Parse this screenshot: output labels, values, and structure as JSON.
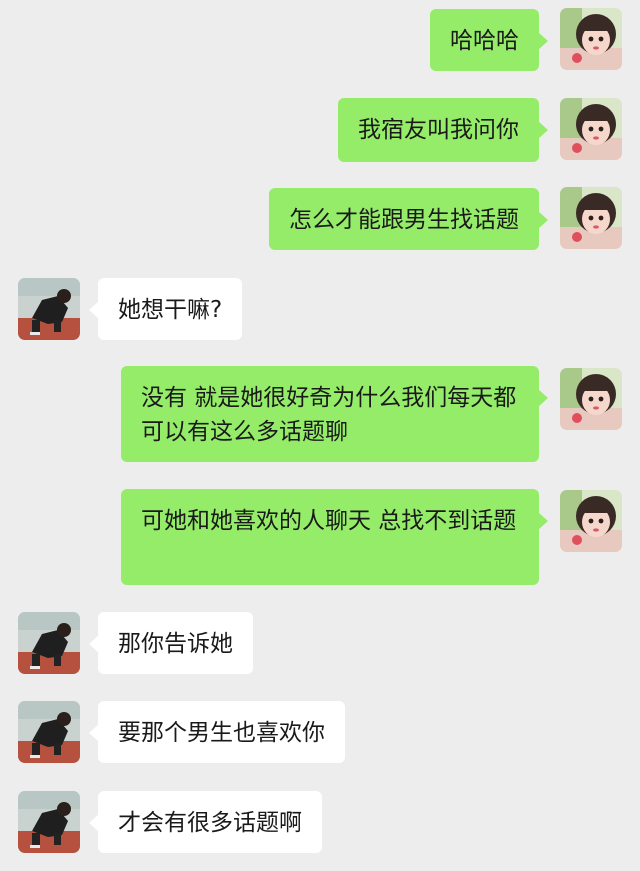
{
  "chat": {
    "messages": [
      {
        "sender": "me",
        "text": "哈哈哈"
      },
      {
        "sender": "me",
        "text": "我宿友叫我问你"
      },
      {
        "sender": "me",
        "text": "怎么才能跟男生找话题"
      },
      {
        "sender": "them",
        "text": "她想干嘛?"
      },
      {
        "sender": "me",
        "text": "没有 就是她很好奇为什么我们每天都可以有这么多话题聊"
      },
      {
        "sender": "me",
        "text": "可她和她喜欢的人聊天 总找不到话题"
      },
      {
        "sender": "them",
        "text": "那你告诉她"
      },
      {
        "sender": "them",
        "text": "要那个男生也喜欢你"
      },
      {
        "sender": "them",
        "text": "才会有很多话题啊"
      }
    ]
  },
  "colors": {
    "background": "#ededed",
    "bubble_me": "#95ec69",
    "bubble_them": "#ffffff"
  }
}
